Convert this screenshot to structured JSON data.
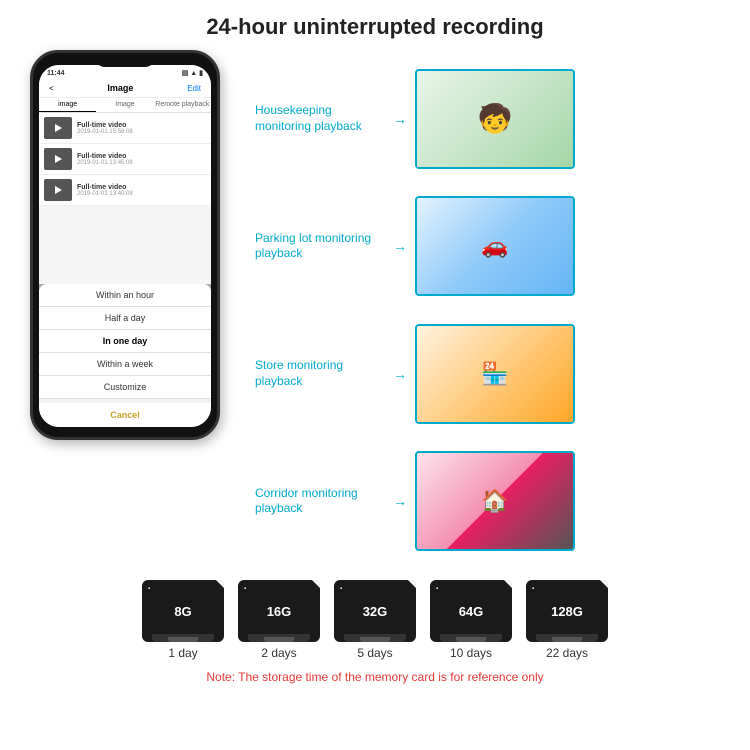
{
  "page": {
    "title": "24-hour uninterrupted recording"
  },
  "phone": {
    "time": "11:44",
    "nav": {
      "back": "<",
      "title": "Image",
      "edit": "Edit"
    },
    "tabs": [
      "image",
      "Image",
      "Remote playback"
    ],
    "videos": [
      {
        "title": "Full-time video",
        "date": "2019-01-01 15:58:08"
      },
      {
        "title": "Full-time video",
        "date": "2019-01-01 13:45:08"
      },
      {
        "title": "Full-time video",
        "date": "2019-01-01 13:40:08"
      }
    ],
    "dropdown": {
      "items": [
        "Within an hour",
        "Half a day",
        "In one day",
        "Within a week",
        "Customize"
      ],
      "active_index": 2,
      "cancel": "Cancel"
    }
  },
  "monitoring": [
    {
      "label": "Housekeeping monitoring playback",
      "photo_type": "child"
    },
    {
      "label": "Parking lot monitoring playback",
      "photo_type": "parking"
    },
    {
      "label": "Store monitoring playback",
      "photo_type": "store"
    },
    {
      "label": "Corridor monitoring playback",
      "photo_type": "corridor"
    }
  ],
  "sd_cards": [
    {
      "size": "8G",
      "days": "1 day"
    },
    {
      "size": "16G",
      "days": "2 days"
    },
    {
      "size": "32G",
      "days": "5 days"
    },
    {
      "size": "64G",
      "days": "10 days"
    },
    {
      "size": "128G",
      "days": "22 days"
    }
  ],
  "note": "Note: The storage time of the memory card is for reference only",
  "colors": {
    "accent": "#00aacc",
    "note_red": "#e53935"
  }
}
